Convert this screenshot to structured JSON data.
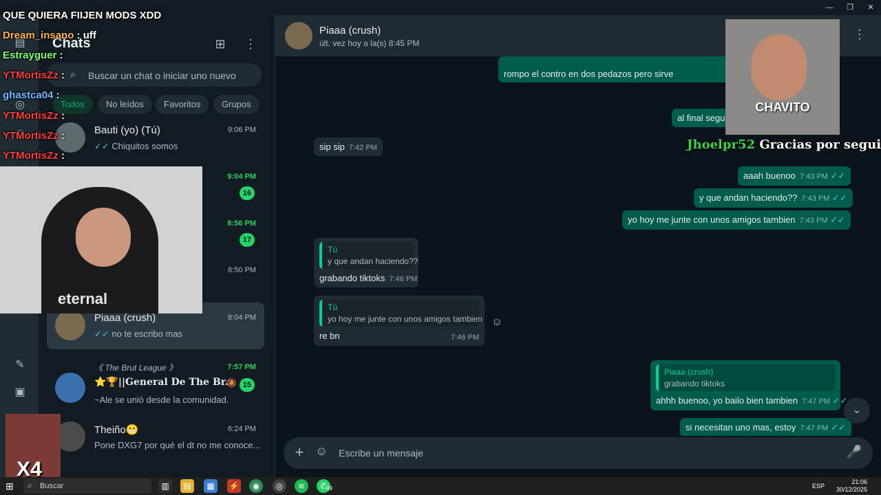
{
  "window": {
    "minimize_label": "—",
    "maximize_label": "❐",
    "close_label": "✕"
  },
  "rail": {
    "icons": [
      "chats-icon",
      "status-icon",
      "channels-icon",
      "communities-icon",
      "starred-icon",
      "media-icon"
    ],
    "chats_glyph": "▤",
    "status_glyph": "○",
    "channels_glyph": "◎",
    "communities_glyph": "⚇",
    "starred_glyph": "✎",
    "media_glyph": "▣"
  },
  "chatlist": {
    "title": "Chats",
    "new_chat_glyph": "⊞",
    "menu_glyph": "⋮",
    "search_placeholder": "Buscar un chat o iniciar uno nuevo",
    "search_glyph": "⌕",
    "filters": [
      "Todos",
      "No leídos",
      "Favoritos",
      "Grupos"
    ],
    "rows": [
      {
        "name": "Bauti (yo) (Tú)",
        "preview": "Chiquitos somos",
        "time": "9:06 PM",
        "read": "✓✓",
        "unread": ""
      },
      {
        "name": "",
        "preview": "",
        "time": "9:04 PM",
        "read": "",
        "unread": "16"
      },
      {
        "name": "",
        "preview": "",
        "time": "8:56 PM",
        "read": "",
        "unread": "17"
      },
      {
        "name": "",
        "preview": "",
        "time": "8:50 PM",
        "read": "",
        "unread": ""
      },
      {
        "name": "Piaaa (crush)",
        "preview": "no te escribo mas",
        "time": "8:04 PM",
        "read": "✓✓",
        "unread": ""
      },
      {
        "name": "⭐🏆||General De The Br...",
        "community": "《 The Brut League 》",
        "preview": "~Ale se unió desde la comunidad.",
        "time": "7:57 PM",
        "read": "",
        "unread": "15",
        "muted_glyph": "🔕"
      },
      {
        "name": "Theiño😬",
        "preview": "Pone DXG7 por qué el dt no me conoce...",
        "time": "6:24 PM",
        "read": "",
        "unread": ""
      }
    ]
  },
  "chat": {
    "contact_name": "Piaaa (crush)",
    "status": "últ. vez hoy a la(s) 8:45 PM",
    "menu_glyph": "⋮",
    "messages": [
      {
        "dir": "out",
        "text": "rompo el contro en dos pedazos pero sirve",
        "time": ""
      },
      {
        "dir": "out",
        "text": "al final segu",
        "time": ""
      },
      {
        "dir": "in",
        "text": "sip sip",
        "time": "7:42 PM"
      },
      {
        "dir": "out",
        "text": "aaah buenoo",
        "time": "7:43 PM",
        "ticks": "✓✓"
      },
      {
        "dir": "out",
        "text": "y que andan haciendo??",
        "time": "7:43 PM",
        "ticks": "✓✓"
      },
      {
        "dir": "out",
        "text": "yo hoy me junte con unos amigos tambien",
        "time": "7:43 PM",
        "ticks": "✓✓"
      },
      {
        "dir": "in",
        "quote_name": "Tú",
        "quote_text": "y que andan haciendo??",
        "text": "grabando tiktoks",
        "time": "7:46 PM"
      },
      {
        "dir": "in",
        "quote_name": "Tú",
        "quote_text": "yo hoy me junte con unos amigos tambien",
        "text": "re bn",
        "time": "7:46 PM"
      },
      {
        "dir": "out",
        "quote_name": "Piaaa (crush)",
        "quote_text": "grabando tiktoks",
        "text": "ahhh buenoo, yo bailo bien tambien",
        "time": "7:47 PM",
        "ticks": "✓✓"
      },
      {
        "dir": "out",
        "text": "si necesitan uno mas, estoy",
        "time": "7:47 PM",
        "ticks": "✓✓"
      }
    ],
    "react_glyph": "☺",
    "scroll_down_glyph": "⌄",
    "composer": {
      "placeholder": "Escribe un mensaje",
      "plus_glyph": "+",
      "emoji_glyph": "☺",
      "mic_glyph": "🎤"
    }
  },
  "overlay": {
    "top_line": "QUE QUIERA FIIJEN MODS XDD",
    "lines": [
      {
        "user": "Dream_insano",
        "msg": ": uff"
      },
      {
        "user": "Estrayguer",
        "msg": ":"
      },
      {
        "user": "YTMortisZz",
        "msg": ":"
      },
      {
        "user": "ghastca04",
        "msg": ":"
      },
      {
        "user": "YTMortisZz",
        "msg": ":"
      },
      {
        "user": "YTMortisZz",
        "msg": ":"
      },
      {
        "user": "YTMortisZz",
        "msg": ":"
      }
    ],
    "webcam_shirt": "eternal",
    "chavito_label": "CHAVITO",
    "follow_user": "Jhoelpr52",
    "follow_text": "Gracias por seguirme!!",
    "x4_label": "X4"
  },
  "taskbar": {
    "start_glyph": "⊞",
    "search_label": "Buscar",
    "whatsapp_badge": "49",
    "lang": "ESP",
    "clock_time": "21:06",
    "clock_date": "30/12/2025"
  },
  "colors": {
    "accent": "#00a884",
    "unread_green": "#25d366",
    "outgoing_bubble": "#005c4b",
    "incoming_bubble": "#202c33",
    "read_tick": "#53bdeb"
  }
}
